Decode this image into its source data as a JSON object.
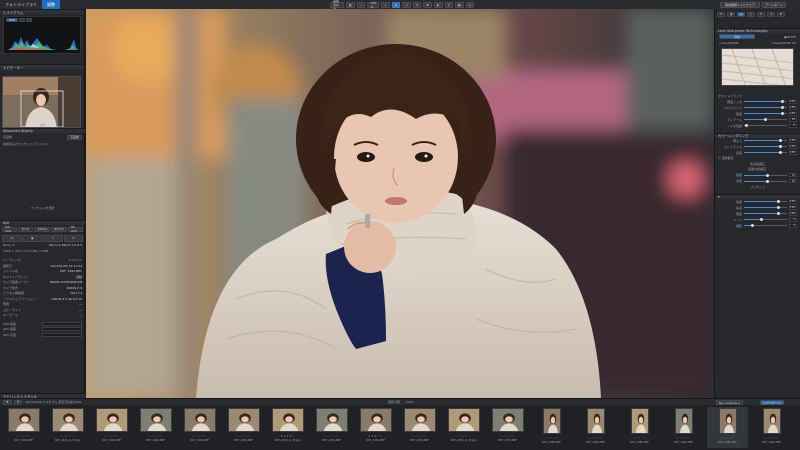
{
  "app": {
    "tabs": [
      "フォトライブラリ",
      "調整"
    ],
    "active_tab": 1
  },
  "toolbar": {
    "fit_label": "画面合わせ",
    "zoom_value": "100 %",
    "right_btn_1": "構成書類ミドルウェア",
    "right_btn_2": "アートボード"
  },
  "left_panel": {
    "histogram_title": "ヒストグラム",
    "rgb_label": "RGB",
    "navigator_title": "ナビゲーター",
    "image_label": "画像",
    "history_title": "Advanced History",
    "history_items": [
      "元画像",
      "適用済みのプリセット/アジャスト"
    ],
    "history_btn_label": "元画像",
    "preset_label": "プリセットを選択",
    "exif_title": "Exif",
    "exif_values": [
      "ISO 100",
      "f/1.8",
      "1/800s",
      "85mm",
      "85 mm"
    ],
    "lens_label": "Nikon Z",
    "lens_value": "Nikon Z 85mm f/1.8 S",
    "file_label": "3008 × 4512 (13.5 MP) 2.5MB",
    "meta_rows": [
      {
        "k": "レーティング",
        "v": "☆☆☆☆☆"
      },
      {
        "k": "撮影日",
        "v": "2023/01/30 14:21:44"
      },
      {
        "k": "ファイル名",
        "v": "DSF_2462.NEF"
      },
      {
        "k": "ホワイトバランス",
        "v": "自動"
      },
      {
        "k": "カメラ製造メーカー",
        "v": "NIKON CORPORATION"
      },
      {
        "k": "カメラ形式",
        "v": "NIKON Z 9"
      },
      {
        "k": "ピクセル解像度",
        "v": "3017×4"
      },
      {
        "k": "ソフトウェアバージョン",
        "v": "NIKON Z 9 Ver.04.10"
      },
      {
        "k": "著者",
        "v": "—"
      },
      {
        "k": "コピーライト",
        "v": "—"
      },
      {
        "k": "キーワード",
        "v": "—"
      }
    ],
    "gps_rows": [
      "GPS 緯度",
      "GPS 経度",
      "GPS 高度"
    ],
    "bottom_title": "アドバンストスタジオ"
  },
  "right_panel": {
    "header_label": "Lens Sharpness Technologies",
    "opt_left": "自動",
    "opt_right": "PRIME",
    "opt_left2": "DeepPRIME",
    "opt_right2": "DeepPRIME XD",
    "section1": "ホワイトバランス",
    "section1_rows": [
      {
        "label": "輝度ノイズ",
        "value": "100",
        "pct": 0.9
      },
      {
        "label": "クロミナンス",
        "value": "100",
        "pct": 0.9
      },
      {
        "label": "強度",
        "value": "100",
        "pct": 0.9
      },
      {
        "label": "ディテール",
        "value": "50",
        "pct": 0.5
      },
      {
        "label": "ノイズ低減",
        "value": "0",
        "pct": 0.05
      }
    ],
    "section2": "カラーレンダリング",
    "section2_rows": [
      {
        "label": "明るさ",
        "value": "100",
        "pct": 0.85
      },
      {
        "label": "コントラスト",
        "value": "100",
        "pct": 0.85
      },
      {
        "label": "彩度",
        "value": "100",
        "pct": 0.85
      }
    ],
    "check_label": "自動補正",
    "sub_label": "色収差補正",
    "sub_label2": "画素欠陥補正",
    "section3_rows": [
      {
        "label": "強度",
        "value": "50",
        "pct": 0.55
      },
      {
        "label": "半径",
        "value": "50",
        "pct": 0.55
      }
    ],
    "section3_btn": "プリセット",
    "section4_rows": [
      {
        "label": "色相",
        "value": "100",
        "pct": 0.8
      },
      {
        "label": "彩度",
        "value": "100",
        "pct": 0.8
      },
      {
        "label": "明度",
        "value": "100",
        "pct": 0.8
      },
      {
        "label": "トーン",
        "value": "0",
        "pct": 0.4
      },
      {
        "label": "調整",
        "value": "0",
        "pct": 0.2
      }
    ]
  },
  "filmstrip": {
    "path": "2024/0102 ヤマダさん 東京日比谷 RAW",
    "sort_label": "撮影日時",
    "count_label": "2055",
    "right_tab": "Nik Collection",
    "export_label": "エクスポート",
    "items": [
      {
        "name": "DSF_2445.NEF",
        "stars": "☆☆☆☆☆",
        "portrait": false
      },
      {
        "name": "DSF_2446_G_3K.jpg",
        "stars": "☆☆☆☆☆",
        "portrait": false
      },
      {
        "name": "DSF_2446.NEF",
        "stars": "☆☆☆☆☆",
        "portrait": false
      },
      {
        "name": "DSF_2448.NEF",
        "stars": "☆☆☆☆☆",
        "portrait": false
      },
      {
        "name": "DSF_2449.NEF",
        "stars": "☆☆☆☆☆",
        "portrait": false
      },
      {
        "name": "DSF_2450.NEF",
        "stars": "☆☆☆☆☆",
        "portrait": false
      },
      {
        "name": "DSF_2450_G_3K.jpg",
        "stars": "★★★★☆",
        "portrait": false
      },
      {
        "name": "DSF_2451.NEF",
        "stars": "☆☆☆☆☆",
        "portrait": false
      },
      {
        "name": "DSF_2452.NEF",
        "stars": "★★★☆☆",
        "portrait": false
      },
      {
        "name": "DSF_2454.NEF",
        "stars": "☆☆☆☆☆",
        "portrait": false
      },
      {
        "name": "DSF_2456_G_3K.jpg",
        "stars": "☆☆☆☆☆",
        "portrait": false
      },
      {
        "name": "DSF_2457.NEF",
        "stars": "☆☆☆☆☆",
        "portrait": false
      },
      {
        "name": "DSF_2458.NEF",
        "stars": "☆☆☆☆☆",
        "portrait": true
      },
      {
        "name": "DSF_2459.NEF",
        "stars": "☆☆☆☆☆",
        "portrait": true
      },
      {
        "name": "DSF_2460.NEF",
        "stars": "☆☆☆☆☆",
        "portrait": true
      },
      {
        "name": "DSF_2461.NEF",
        "stars": "☆☆☆☆☆",
        "portrait": true
      },
      {
        "name": "DSF_2462.NEF",
        "stars": "☆☆☆☆☆",
        "portrait": true
      },
      {
        "name": "DSF_2463.NEF",
        "stars": "☆☆☆☆☆",
        "portrait": true
      }
    ]
  },
  "colors": {
    "accent": "#1f6fc1",
    "panel": "#26282b",
    "slider_fill": "#3d8de0"
  }
}
